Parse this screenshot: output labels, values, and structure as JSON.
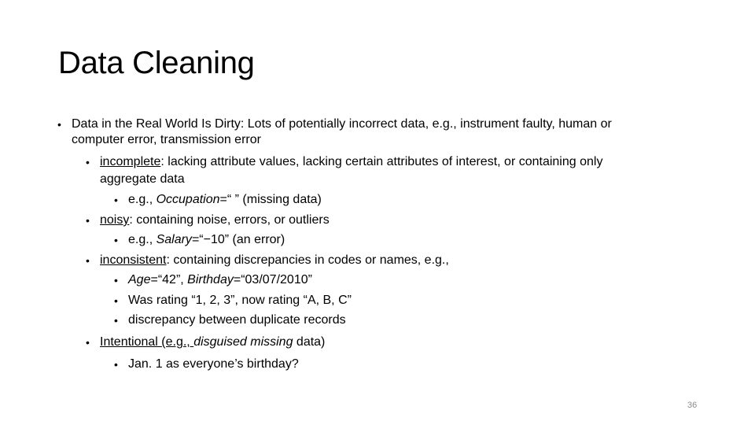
{
  "slide": {
    "title": "Data Cleaning",
    "page_number": "36",
    "bullet_glyph": "•",
    "items": {
      "l1_line1": "Data in the Real World Is Dirty: Lots of potentially incorrect data, e.g., instrument faulty, human or",
      "l1_line2": "computer error, transmission error",
      "incomplete_term": "incomplete",
      "incomplete_rest": ": lacking attribute values, lacking certain attributes of interest, or containing only",
      "incomplete_line2": "aggregate data",
      "occupation_prefix": "e.g., ",
      "occupation_attr": "Occupation",
      "occupation_rest": "=“ ” (missing data)",
      "noisy_term": "noisy",
      "noisy_rest": ": containing noise, errors, or outliers",
      "salary_prefix": "e.g., ",
      "salary_attr": "Salary",
      "salary_rest": "=“−10” (an error)",
      "inconsistent_term": "inconsistent",
      "inconsistent_rest": ": containing discrepancies in codes or names, e.g.,",
      "age_attr": "Age",
      "age_mid": "=“42”, ",
      "birthday_attr": "Birthday",
      "birthday_rest": "=“03/07/2010”",
      "rating": "Was rating “1, 2, 3”, now rating “A, B, C”",
      "discrepancy": "discrepancy between duplicate records",
      "intentional_term": "Intentional ",
      "intentional_mid": "(e.g., ",
      "intentional_ital": "disguised missing",
      "intentional_rest": " data)",
      "birthday_example": "Jan. 1 as everyone’s birthday?"
    }
  }
}
